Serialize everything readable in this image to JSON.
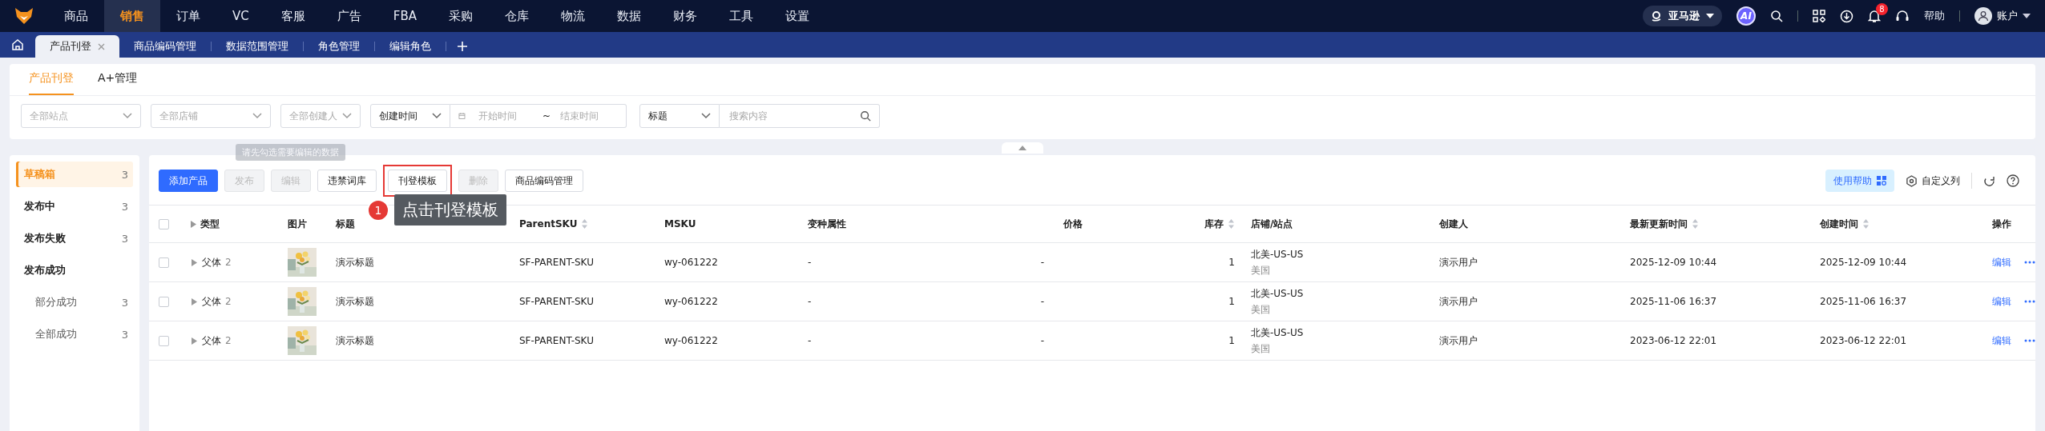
{
  "nav": {
    "items": [
      {
        "label": "商品",
        "selected": false
      },
      {
        "label": "销售",
        "selected": true
      },
      {
        "label": "订单",
        "selected": false
      },
      {
        "label": "VC",
        "selected": false
      },
      {
        "label": "客服",
        "selected": false
      },
      {
        "label": "广告",
        "selected": false
      },
      {
        "label": "FBA",
        "selected": false
      },
      {
        "label": "采购",
        "selected": false
      },
      {
        "label": "仓库",
        "selected": false
      },
      {
        "label": "物流",
        "selected": false
      },
      {
        "label": "数据",
        "selected": false
      },
      {
        "label": "财务",
        "selected": false
      },
      {
        "label": "工具",
        "selected": false
      },
      {
        "label": "设置",
        "selected": false
      }
    ],
    "platform": "亚马逊",
    "ai": "AI",
    "notifications": "8",
    "help": "帮助",
    "account": "账户"
  },
  "tabs": [
    {
      "label": "产品刊登",
      "selected": true
    },
    {
      "label": "商品编码管理",
      "selected": false
    },
    {
      "label": "数据范围管理",
      "selected": false
    },
    {
      "label": "角色管理",
      "selected": false
    },
    {
      "label": "编辑角色",
      "selected": false
    }
  ],
  "sub_tabs": [
    {
      "label": "产品刊登",
      "selected": true
    },
    {
      "label": "A+管理",
      "selected": false
    }
  ],
  "filters": {
    "site": {
      "placeholder": "全部站点"
    },
    "store": {
      "placeholder": "全部店铺"
    },
    "creator": {
      "placeholder": "全部创建人"
    },
    "time_type": "创建时间",
    "start": {
      "placeholder": "开始时间"
    },
    "separator": "~",
    "end": {
      "placeholder": "结束时间"
    },
    "search_type": "标题",
    "search": {
      "placeholder": "搜索内容"
    }
  },
  "sidebar": {
    "items": [
      {
        "label": "草稿箱",
        "count": "3",
        "selected": true
      },
      {
        "label": "发布中",
        "count": "3",
        "selected": false
      },
      {
        "label": "发布失败",
        "count": "3",
        "selected": false
      },
      {
        "label": "发布成功",
        "selected": false,
        "children": [
          {
            "label": "部分成功",
            "count": "3",
            "selected": false
          },
          {
            "label": "全部成功",
            "count": "3",
            "selected": false
          }
        ]
      }
    ]
  },
  "toolbar": {
    "buttons": [
      {
        "label": "添加产品",
        "kind": "primary",
        "disabled": false,
        "highlighted": false
      },
      {
        "label": "发布",
        "kind": "default",
        "disabled": true,
        "highlighted": false
      },
      {
        "label": "编辑",
        "kind": "default",
        "disabled": true,
        "highlighted": false
      },
      {
        "label": "违禁词库",
        "kind": "default",
        "disabled": false,
        "highlighted": false
      },
      {
        "label": "刊登模板",
        "kind": "default",
        "disabled": false,
        "highlighted": true
      },
      {
        "label": "删除",
        "kind": "default",
        "disabled": true,
        "highlighted": false
      },
      {
        "label": "商品编码管理",
        "kind": "default",
        "disabled": false,
        "highlighted": false
      }
    ],
    "tooltip": "请先勾选需要编辑的数据",
    "help": "使用帮助",
    "columns": "自定义列"
  },
  "callout": {
    "step": "1",
    "text": "点击刊登模板"
  },
  "table": {
    "select_all_checked": false,
    "columns": [
      {
        "label": "类型",
        "sortable": false
      },
      {
        "label": "图片",
        "sortable": false
      },
      {
        "label": "标题",
        "sortable": false
      },
      {
        "label": "ParentSKU",
        "sortable": true
      },
      {
        "label": "MSKU",
        "sortable": false
      },
      {
        "label": "变种属性",
        "sortable": false
      },
      {
        "label": "价格",
        "sortable": false
      },
      {
        "label": "库存",
        "sortable": true
      },
      {
        "label": "店铺/站点",
        "sortable": false
      },
      {
        "label": "创建人",
        "sortable": false
      },
      {
        "label": "最新更新时间",
        "sortable": true
      },
      {
        "label": "创建时间",
        "sortable": true
      },
      {
        "label": "操作",
        "sortable": false
      }
    ],
    "rows": [
      {
        "checked": false,
        "expanded": false,
        "type": "父体",
        "count": "2",
        "title": "演示标题",
        "parent_sku": "SF-PARENT-SKU",
        "msku": "wy-061222",
        "variant": "-",
        "price": "-",
        "stock": "1",
        "store": "北美-US-US",
        "country": "美国",
        "creator": "演示用户",
        "updated": "2025-12-09 10:44",
        "created": "2025-12-09 10:44",
        "action": "编辑"
      },
      {
        "checked": false,
        "expanded": false,
        "type": "父体",
        "count": "2",
        "title": "演示标题",
        "parent_sku": "SF-PARENT-SKU",
        "msku": "wy-061222",
        "variant": "-",
        "price": "-",
        "stock": "1",
        "store": "北美-US-US",
        "country": "美国",
        "creator": "演示用户",
        "updated": "2025-11-06 16:37",
        "created": "2025-11-06 16:37",
        "action": "编辑"
      },
      {
        "checked": false,
        "expanded": false,
        "type": "父体",
        "count": "2",
        "title": "演示标题",
        "parent_sku": "SF-PARENT-SKU",
        "msku": "wy-061222",
        "variant": "-",
        "price": "-",
        "stock": "1",
        "store": "北美-US-US",
        "country": "美国",
        "creator": "演示用户",
        "updated": "2023-06-12 22:01",
        "created": "2023-06-12 22:01",
        "action": "编辑"
      }
    ]
  }
}
